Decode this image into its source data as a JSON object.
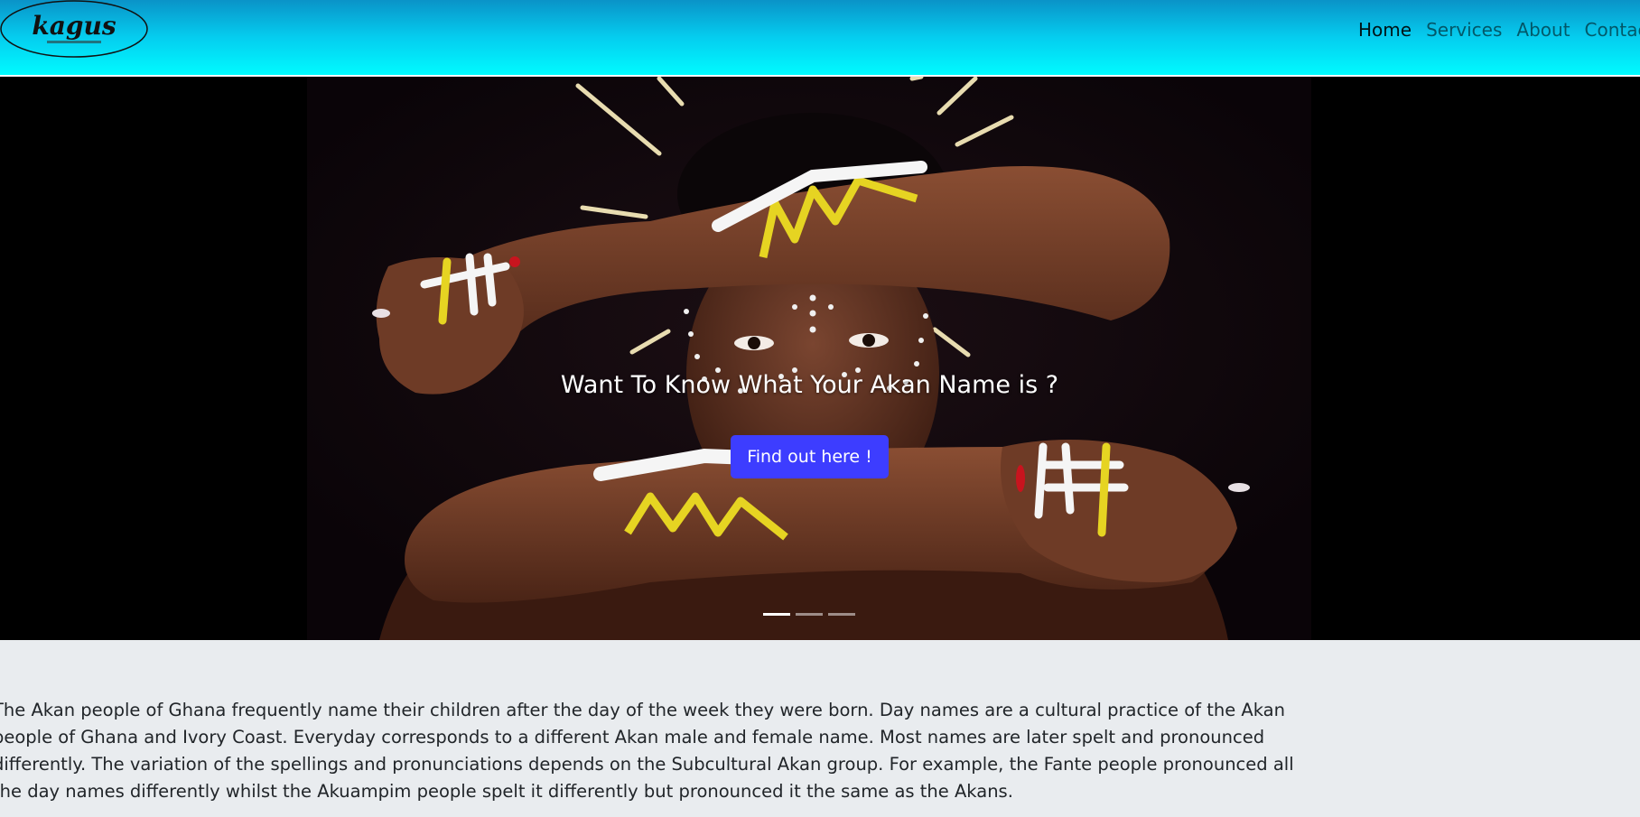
{
  "header": {
    "logo_text": "kagus",
    "nav": [
      {
        "label": "Home",
        "active": true
      },
      {
        "label": "Services",
        "active": false
      },
      {
        "label": "About",
        "active": false
      },
      {
        "label": "Contact",
        "active": false
      }
    ]
  },
  "hero": {
    "heading": "Want To Know What Your Akan Name is ?",
    "button_label": "Find out here !",
    "slide_count": 3,
    "active_slide": 1
  },
  "about": {
    "text": "The Akan people of Ghana frequently name their children after the day of the week they were born. Day names are a cultural practice of the Akan people of Ghana and Ivory Coast. Everyday corresponds to a different Akan male and female name. Most names are later spelt and pronounced differently. The variation of the spellings and pronunciations depends on the Subcultural Akan group. For example, the Fante people pronounced all the day names differently whilst the Akuampim people spelt it differently but pronounced it the same as the Akans."
  },
  "colors": {
    "header_top": "#0a93c8",
    "header_bottom": "#00fbff",
    "button": "#3d3dff",
    "page_bg": "#e9ecef"
  }
}
